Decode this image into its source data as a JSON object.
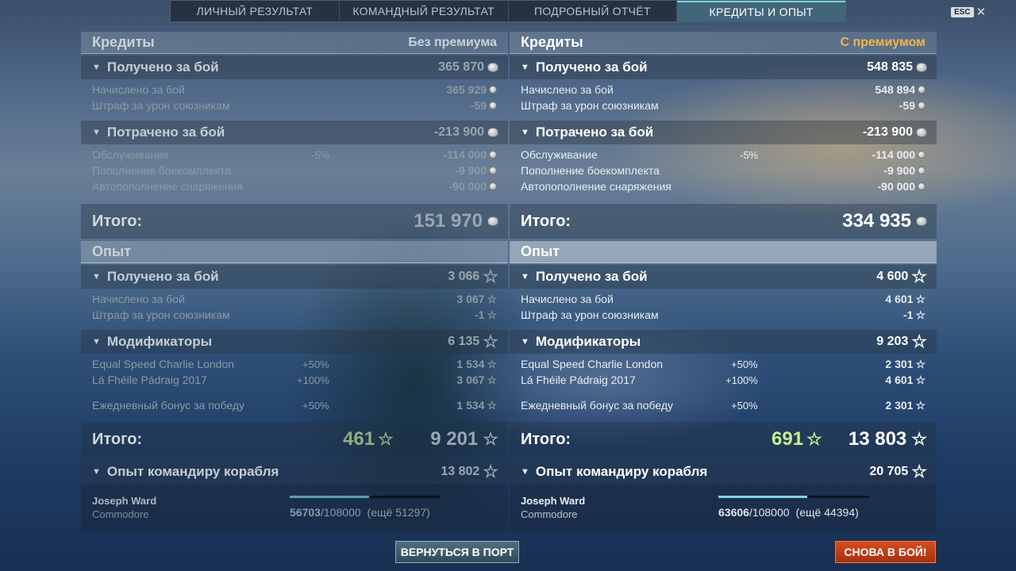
{
  "tabs": [
    {
      "label": "ЛИЧНЫЙ РЕЗУЛЬТАТ",
      "active": false
    },
    {
      "label": "КОМАНДНЫЙ РЕЗУЛЬТАТ",
      "active": false
    },
    {
      "label": "ПОДРОБНЫЙ ОТЧЁТ",
      "active": false
    },
    {
      "label": "КРЕДИТЫ И ОПЫТ",
      "active": true
    }
  ],
  "esc": {
    "key": "ESC",
    "close": "✕"
  },
  "left": {
    "credits_title": "Кредиты",
    "mode": "Без премиума",
    "earned": {
      "label": "Получено за бой",
      "value": "365 870"
    },
    "earned_rows": [
      {
        "label": "Начислено за бой",
        "value": "365 929"
      },
      {
        "label": "Штраф за урон союзникам",
        "value": "-59"
      }
    ],
    "spent": {
      "label": "Потрачено за бой",
      "value": "-213 900"
    },
    "spent_rows": [
      {
        "label": "Обслуживание",
        "pct": "-5%",
        "value": "-114 000"
      },
      {
        "label": "Пополнение боекомплекта",
        "pct": "",
        "value": "-9 900"
      },
      {
        "label": "Автопополнение снаряжения",
        "pct": "",
        "value": "-90 000"
      }
    ],
    "credits_total": {
      "label": "Итого:",
      "value": "151 970"
    },
    "exp_title": "Опыт",
    "exp_earned": {
      "label": "Получено за бой",
      "value": "3 066"
    },
    "exp_earned_rows": [
      {
        "label": "Начислено за бой",
        "value": "3 067"
      },
      {
        "label": "Штраф за урон союзникам",
        "value": "-1"
      }
    ],
    "modifiers": {
      "label": "Модификаторы",
      "value": "6 135"
    },
    "modifier_rows": [
      {
        "label": "Equal Speed Charlie London",
        "pct": "+50%",
        "value": "1 534"
      },
      {
        "label": "Lá Fhéile Pádraig 2017",
        "pct": "+100%",
        "value": "3 067"
      },
      {
        "label": "Ежедневный бонус за победу",
        "pct": "+50%",
        "value": "1 534"
      }
    ],
    "exp_total": {
      "label": "Итого:",
      "free": "461",
      "value": "9 201"
    },
    "commander": {
      "label": "Опыт командиру корабля",
      "value": "13 802",
      "name": "Joseph Ward",
      "rank": "Commodore",
      "xp": "56703",
      "xp_max": "/108000",
      "xp_rest": "(ещё 51297)",
      "progress": 0.525
    }
  },
  "right": {
    "credits_title": "Кредиты",
    "mode": "С премиумом",
    "earned": {
      "label": "Получено за бой",
      "value": "548 835"
    },
    "earned_rows": [
      {
        "label": "Начислено за бой",
        "value": "548 894"
      },
      {
        "label": "Штраф за урон союзникам",
        "value": "-59"
      }
    ],
    "spent": {
      "label": "Потрачено за бой",
      "value": "-213 900"
    },
    "spent_rows": [
      {
        "label": "Обслуживание",
        "pct": "-5%",
        "value": "-114 000"
      },
      {
        "label": "Пополнение боекомплекта",
        "pct": "",
        "value": "-9 900"
      },
      {
        "label": "Автопополнение снаряжения",
        "pct": "",
        "value": "-90 000"
      }
    ],
    "credits_total": {
      "label": "Итого:",
      "value": "334 935"
    },
    "exp_title": "Опыт",
    "exp_earned": {
      "label": "Получено за бой",
      "value": "4 600"
    },
    "exp_earned_rows": [
      {
        "label": "Начислено за бой",
        "value": "4 601"
      },
      {
        "label": "Штраф за урон союзникам",
        "value": "-1"
      }
    ],
    "modifiers": {
      "label": "Модификаторы",
      "value": "9 203"
    },
    "modifier_rows": [
      {
        "label": "Equal Speed Charlie London",
        "pct": "+50%",
        "value": "2 301"
      },
      {
        "label": "Lá Fhéile Pádraig 2017",
        "pct": "+100%",
        "value": "4 601"
      },
      {
        "label": "Ежедневный бонус за победу",
        "pct": "+50%",
        "value": "2 301"
      }
    ],
    "exp_total": {
      "label": "Итого:",
      "free": "691",
      "value": "13 803"
    },
    "commander": {
      "label": "Опыт командиру корабля",
      "value": "20 705",
      "name": "Joseph Ward",
      "rank": "Commodore",
      "xp": "63606",
      "xp_max": "/108000",
      "xp_rest": "(ещё 44394)",
      "progress": 0.589
    }
  },
  "buttons": {
    "port": "ВЕРНУТЬСЯ В ПОРТ",
    "battle": "СНОВА В БОЙ!"
  },
  "colors": {
    "premium": "#f2b64a",
    "battle_button": "#c43a14",
    "active_tab": "#466e82"
  },
  "icons": {
    "credits": "coin-icon",
    "experience": "star-icon",
    "expand": "triangle-down-icon",
    "close": "close-icon"
  }
}
